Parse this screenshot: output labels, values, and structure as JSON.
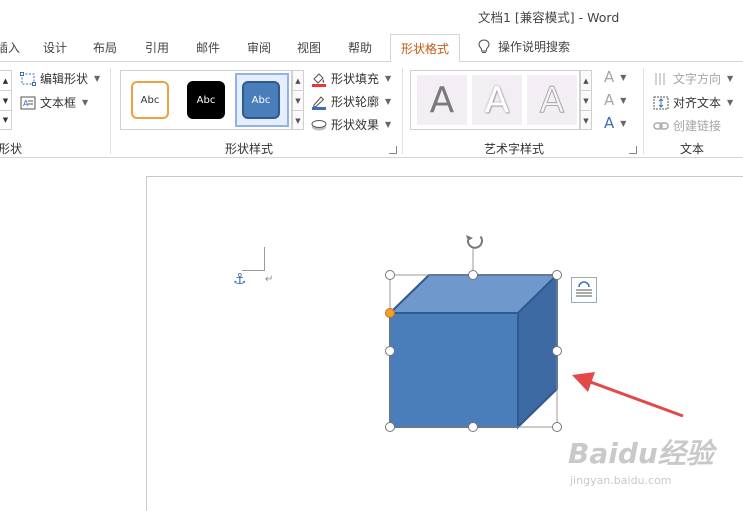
{
  "window": {
    "title": "文档1 [兼容模式]  -  Word"
  },
  "tabs": [
    {
      "label": "插入"
    },
    {
      "label": "设计"
    },
    {
      "label": "布局"
    },
    {
      "label": "引用"
    },
    {
      "label": "邮件"
    },
    {
      "label": "审阅"
    },
    {
      "label": "视图"
    },
    {
      "label": "帮助"
    },
    {
      "label": "形状格式"
    }
  ],
  "tell_me": {
    "label": "操作说明搜索"
  },
  "ribbon": {
    "insert_shapes": {
      "edit_shape": "编辑形状",
      "text_box": "文本框",
      "group_label": "形状"
    },
    "shape_styles": {
      "swatches": [
        "Abc",
        "Abc",
        "Abc"
      ],
      "fill": "形状填充",
      "outline": "形状轮廓",
      "effects": "形状效果",
      "group_label": "形状样式"
    },
    "wordart": {
      "letters": [
        "A",
        "A",
        "A"
      ],
      "side_letters": [
        "A",
        "A",
        "A"
      ],
      "group_label": "艺术字样式"
    },
    "text": {
      "direction": "文字方向",
      "align": "对齐文本",
      "link": "创建链接",
      "group_label": "文本"
    }
  },
  "colors": {
    "accent_tab": "#c55a11",
    "cube_front": "#4a7ebb",
    "cube_top": "#6f99cc",
    "cube_side": "#3d6aa3",
    "cube_stroke": "#2f5a8f",
    "arrow": "#e24a4a",
    "adjust_handle": "#f0a030"
  },
  "watermark": {
    "brand": "Baidu经验",
    "url": "jingyan.baidu.com"
  }
}
